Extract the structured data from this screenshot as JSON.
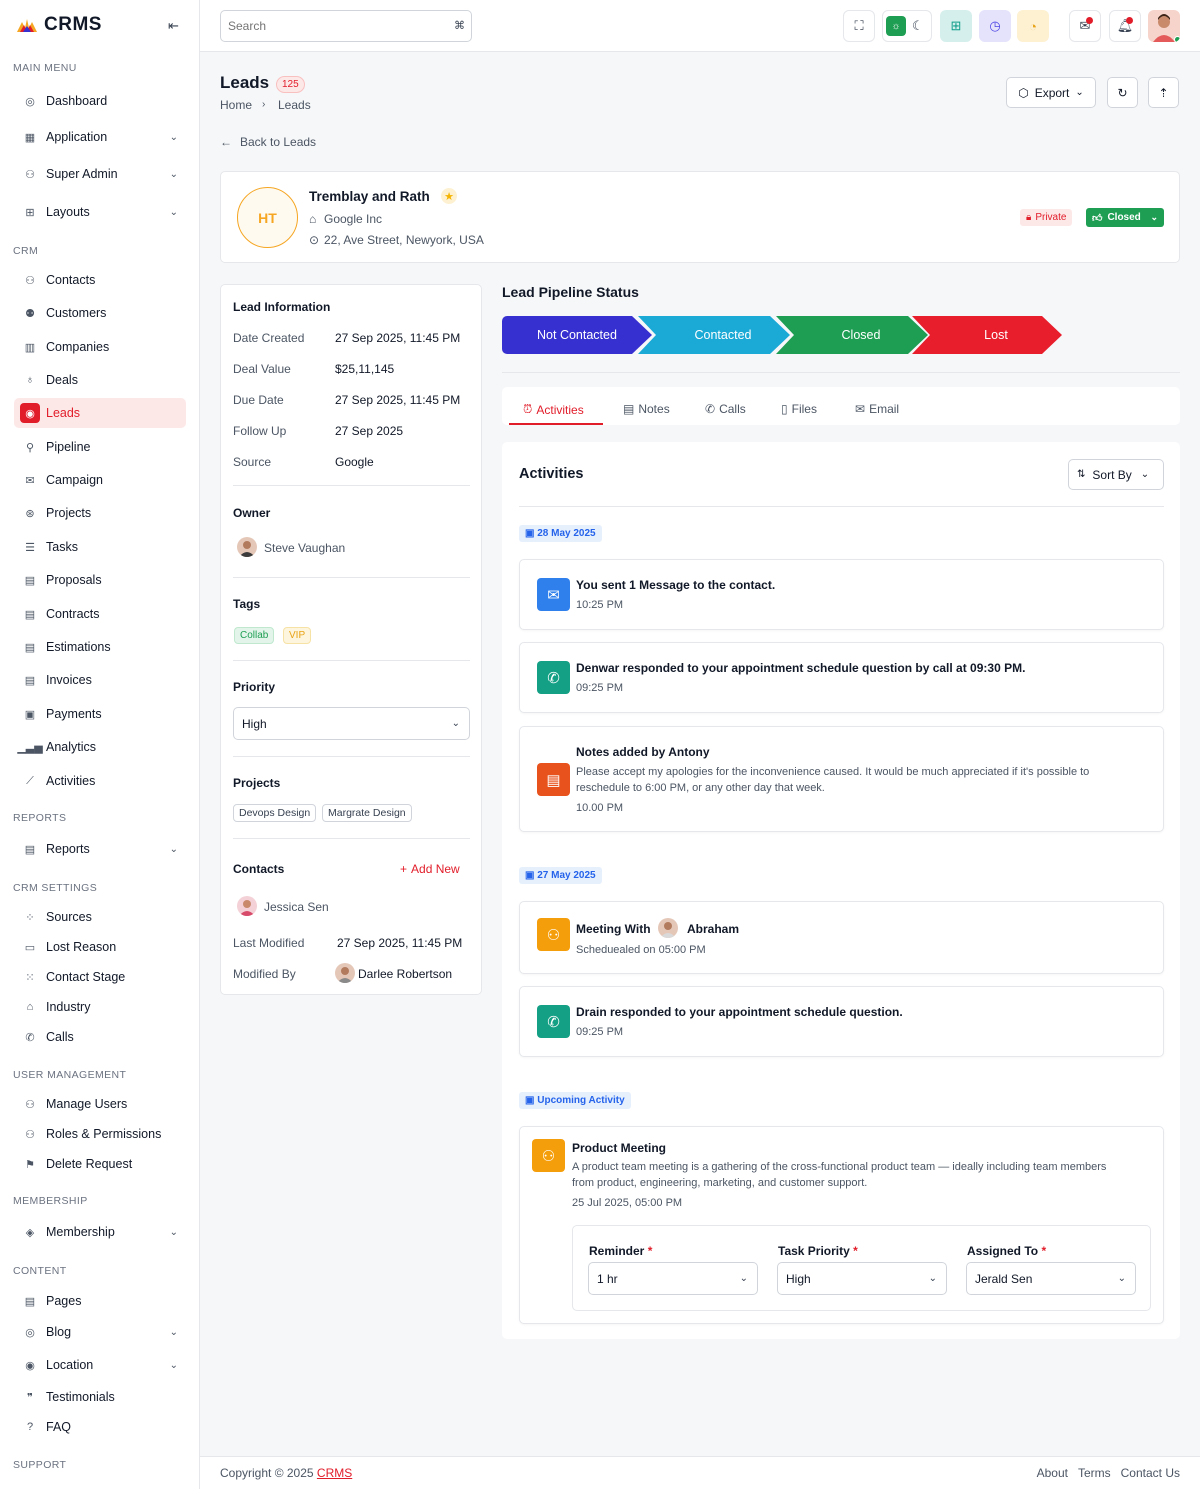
{
  "app": {
    "name": "CRMS"
  },
  "sidebar": {
    "sections": {
      "main": "MAIN MENU",
      "crm": "CRM",
      "reports": "REPORTS",
      "crm_settings": "CRM SETTINGS",
      "user_mgmt": "USER MANAGEMENT",
      "membership": "MEMBERSHIP",
      "content": "CONTENT",
      "support": "SUPPORT"
    },
    "items": [
      {
        "label": "Dashboard"
      },
      {
        "label": "Application"
      },
      {
        "label": "Super Admin"
      },
      {
        "label": "Layouts"
      },
      {
        "label": "Contacts"
      },
      {
        "label": "Customers"
      },
      {
        "label": "Companies"
      },
      {
        "label": "Deals"
      },
      {
        "label": "Leads"
      },
      {
        "label": "Pipeline"
      },
      {
        "label": "Campaign"
      },
      {
        "label": "Projects"
      },
      {
        "label": "Tasks"
      },
      {
        "label": "Proposals"
      },
      {
        "label": "Contracts"
      },
      {
        "label": "Estimations"
      },
      {
        "label": "Invoices"
      },
      {
        "label": "Payments"
      },
      {
        "label": "Analytics"
      },
      {
        "label": "Activities"
      },
      {
        "label": "Reports"
      },
      {
        "label": "Sources"
      },
      {
        "label": "Lost Reason"
      },
      {
        "label": "Contact Stage"
      },
      {
        "label": "Industry"
      },
      {
        "label": "Calls"
      },
      {
        "label": "Manage Users"
      },
      {
        "label": "Roles & Permissions"
      },
      {
        "label": "Delete Request"
      },
      {
        "label": "Membership"
      },
      {
        "label": "Pages"
      },
      {
        "label": "Blog"
      },
      {
        "label": "Location"
      },
      {
        "label": "Testimonials"
      },
      {
        "label": "FAQ"
      }
    ]
  },
  "topbar": {
    "search_placeholder": "Search",
    "shortcut": "⌘"
  },
  "page": {
    "title": "Leads",
    "count": "125",
    "breadcrumb": [
      "Home",
      "Leads"
    ],
    "back": "Back to Leads",
    "export": "Export"
  },
  "lead": {
    "initials": "HT",
    "name": "Tremblay and Rath",
    "company": "Google Inc",
    "address": "22, Ave Street, Newyork, USA",
    "private": "Private",
    "status": "Closed"
  },
  "info": {
    "heading": "Lead Information",
    "rows": [
      {
        "label": "Date Created",
        "value": "27 Sep 2025, 11:45 PM"
      },
      {
        "label": "Deal Value",
        "value": "$25,11,145"
      },
      {
        "label": "Due Date",
        "value": "27 Sep 2025, 11:45 PM"
      },
      {
        "label": "Follow Up",
        "value": "27 Sep 2025"
      },
      {
        "label": "Source",
        "value": "Google"
      }
    ],
    "owner_heading": "Owner",
    "owner": "Steve Vaughan",
    "tags_heading": "Tags",
    "tags": [
      "Collab",
      "VIP"
    ],
    "priority_heading": "Priority",
    "priority": "High",
    "projects_heading": "Projects",
    "projects": [
      "Devops Design",
      "Margrate Design"
    ],
    "contacts_heading": "Contacts",
    "add_new": "Add New",
    "contact": "Jessica Sen",
    "last_modified_label": "Last Modified",
    "last_modified": "27 Sep 2025, 11:45 PM",
    "modified_by_label": "Modified By",
    "modified_by": "Darlee Robertson"
  },
  "pipeline": {
    "heading": "Lead Pipeline Status",
    "stages": [
      {
        "label": "Not Contacted",
        "color": "#3730d0"
      },
      {
        "label": "Contacted",
        "color": "#1ba9d6"
      },
      {
        "label": "Closed",
        "color": "#1e9e53"
      },
      {
        "label": "Lost",
        "color": "#e81e2c"
      }
    ]
  },
  "tabs": [
    {
      "label": "Activities"
    },
    {
      "label": "Notes"
    },
    {
      "label": "Calls"
    },
    {
      "label": "Files"
    },
    {
      "label": "Email"
    }
  ],
  "activities": {
    "heading": "Activities",
    "sort": "Sort By",
    "date1": "28 May 2025",
    "a1": {
      "title": "You sent 1 Message to the contact.",
      "time": "10:25 PM"
    },
    "a2": {
      "title": "Denwar responded to your appointment schedule question by call at 09:30 PM.",
      "time": "09:25 PM"
    },
    "a3": {
      "title": "Notes added by Antony",
      "body1": "Please accept my apologies for the inconvenience caused. It would be much appreciated if it's possible to",
      "body2": "reschedule to 6:00 PM, or any other day that week.",
      "time": "10.00 PM"
    },
    "date2": "27 May 2025",
    "a4": {
      "title": "Meeting With",
      "person": "Abraham",
      "sub": "Scheduealed  on 05:00 PM"
    },
    "a5": {
      "title": "Drain responded to your appointment schedule question.",
      "time": "09:25 PM"
    },
    "upcoming": "Upcoming Activity",
    "a6": {
      "title": "Product Meeting",
      "body1": "A product team meeting is a gathering of the cross-functional product team — ideally including team members",
      "body2": "from product, engineering, marketing, and customer support.",
      "time": "25 Jul 2025, 05:00 PM"
    },
    "form": {
      "reminder_label": "Reminder",
      "reminder": "1 hr",
      "priority_label": "Task Priority",
      "priority": "High",
      "assigned_label": "Assigned To",
      "assigned": "Jerald Sen"
    }
  },
  "footer": {
    "copyright": "Copyright © 2025",
    "brand": "CRMS",
    "links": [
      "About",
      "Terms",
      "Contact Us"
    ]
  }
}
